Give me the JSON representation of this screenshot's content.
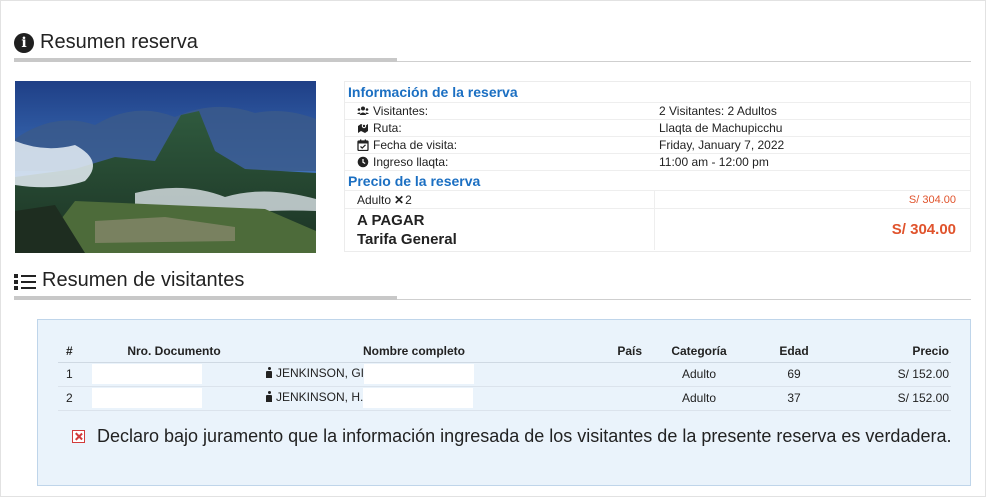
{
  "summary": {
    "heading": "Resumen reserva"
  },
  "reservation": {
    "info_title": "Información de la reserva",
    "rows": [
      {
        "label": "Visitantes:",
        "value": "2 Visitantes: 2 Adultos",
        "icon": "users-icon"
      },
      {
        "label": "Ruta:",
        "value": "Llaqta de Machupicchu",
        "icon": "route-icon"
      },
      {
        "label": "Fecha de visita:",
        "value": "Friday, January 7, 2022",
        "icon": "calendar-check-icon"
      },
      {
        "label": "Ingreso llaqta:",
        "value": "11:00 am - 12:00 pm",
        "icon": "clock-icon"
      }
    ],
    "price_title": "Precio de la reserva",
    "adult_line_label": "Adulto",
    "adult_multiplier": "2",
    "adult_line_value": "S/ 304.00",
    "pay_label": "A PAGAR",
    "tariff_label": "Tarifa General",
    "pay_value": "S/ 304.00"
  },
  "visitors": {
    "heading": "Resumen de visitantes",
    "columns": [
      "#",
      "Nro. Documento",
      "Nombre completo",
      "País",
      "Categoría",
      "Edad",
      "Precio"
    ],
    "rows": [
      {
        "num": "1",
        "name": "JENKINSON, GI",
        "category": "Adulto",
        "age": "69",
        "price": "S/ 152.00"
      },
      {
        "num": "2",
        "name": "JENKINSON, H.",
        "category": "Adulto",
        "age": "37",
        "price": "S/ 152.00"
      }
    ],
    "declaration": "Declaro bajo juramento que la información ingresada de los visitantes de la presente reserva es verdadera."
  },
  "colors": {
    "accent_blue": "#1b6fc2",
    "price_red": "#e0532c",
    "panel_bg": "#eaf3fb"
  }
}
